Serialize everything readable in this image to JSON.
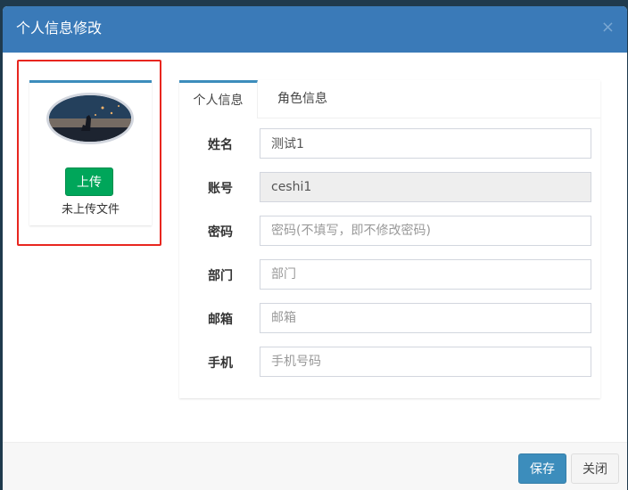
{
  "modal": {
    "title": "个人信息修改",
    "close_glyph": "×"
  },
  "avatar": {
    "upload_label": "上传",
    "upload_status": "未上传文件"
  },
  "tabs": [
    {
      "label": "个人信息",
      "active": true
    },
    {
      "label": "角色信息",
      "active": false
    }
  ],
  "form": {
    "name": {
      "label": "姓名",
      "value": "测试1",
      "placeholder": ""
    },
    "account": {
      "label": "账号",
      "value": "ceshi1",
      "placeholder": ""
    },
    "password": {
      "label": "密码",
      "value": "",
      "placeholder": "密码(不填写，即不修改密码)"
    },
    "department": {
      "label": "部门",
      "value": "",
      "placeholder": "部门"
    },
    "email": {
      "label": "邮箱",
      "value": "",
      "placeholder": "邮箱"
    },
    "phone": {
      "label": "手机",
      "value": "",
      "placeholder": "手机号码"
    }
  },
  "footer": {
    "save_label": "保存",
    "close_label": "关闭"
  },
  "colors": {
    "header": "#3a7ab8",
    "highlight": "#e8261f",
    "upload_button": "#00a65a",
    "save_button": "#3c8dbc"
  },
  "icons": {
    "close": "close-icon"
  }
}
